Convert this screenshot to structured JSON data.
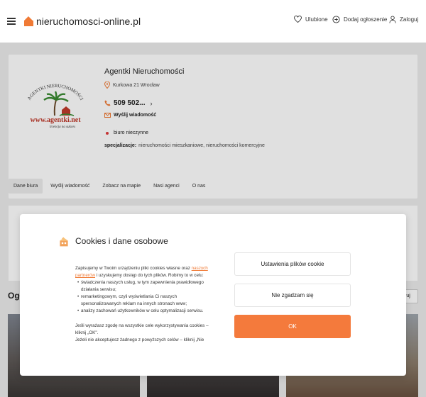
{
  "header": {
    "site_name": "nieruchomosci-online.pl",
    "nav": [
      {
        "label": "Ulubione",
        "icon": "heart-icon"
      },
      {
        "label": "Dodaj ogłoszenie",
        "icon": "plus-circle-icon"
      },
      {
        "label": "Zaloguj",
        "icon": "user-icon"
      }
    ]
  },
  "agency": {
    "name": "Agentki Nieruchomości",
    "address": "Kurkowa 21 Wrocław",
    "phone": "509 502...",
    "send_message": "Wyślij wiadomość",
    "status": "biuro nieczynne",
    "specialization_label": "specjalizacje:",
    "specialization_value": "nieruchomości mieszkaniowe, nieruchomości komercyjne",
    "logo_arc": "AGENTKI NIERUCHOMOŚCI",
    "logo_url": "www.agentki.net",
    "logo_tagline": "licencja na sukces"
  },
  "tabs": [
    "Dane biura",
    "Wyślij wiadomość",
    "Zobacz na mapie",
    "Nasi agenci",
    "O nas"
  ],
  "listings": {
    "title": "Ogł",
    "sort_label": "ruj"
  },
  "cookie": {
    "title": "Cookies i dane osobowe",
    "p1_start": "Zapisujemy w Twoim urządzeniu pliki cookies własne oraz ",
    "p1_link": "naszych partnerów",
    "p1_end": " i uzyskujemy dostęp do tych plików. Robimy to w celu:",
    "bullets": [
      "świadczenia naszych usług, w tym zapewnienia prawidłowego działania serwisu;",
      "remarketingowym, czyli wyświetlania Ci naszych spersonalizowanych reklam na innych stronach www;",
      "analizy zachowań użytkowników w celu optymalizacji serwisu."
    ],
    "p2": "Jeśli wyrażasz zgodę na wszystkie cele wykorzystywania cookies – kliknij „OK\".",
    "p3": "Jeżeli nie akceptujesz żadnego z powyższych celów – kliknij „Nie",
    "settings_button": "Ustawienia plików cookie",
    "decline_button": "Nie zgadzam się",
    "ok_button": "OK"
  },
  "colors": {
    "accent": "#f47a3c",
    "status_dot": "#e03a3a"
  }
}
